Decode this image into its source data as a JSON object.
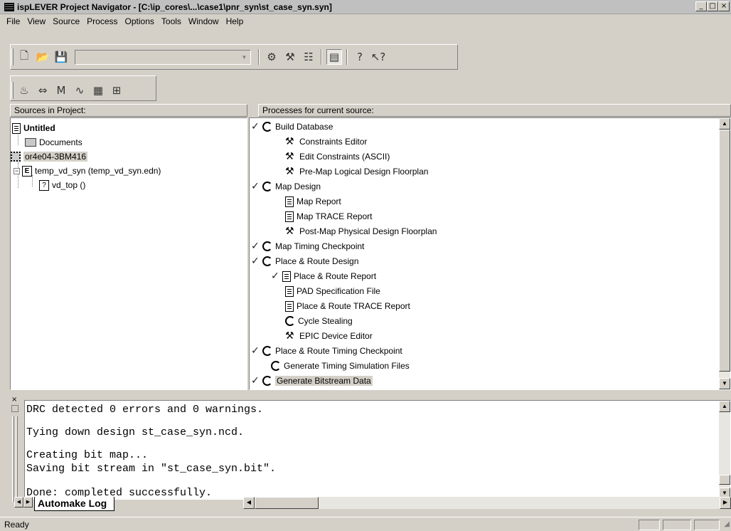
{
  "window": {
    "title": "ispLEVER Project Navigator - [C:\\ip_cores\\...\\case1\\pnr_syn\\st_case_syn.syn]",
    "minimize": "_",
    "maximize": "□",
    "close": "×"
  },
  "menu": [
    "File",
    "View",
    "Source",
    "Process",
    "Options",
    "Tools",
    "Window",
    "Help"
  ],
  "toolbar": {
    "combo_value": ""
  },
  "sources": {
    "header": "Sources in Project:",
    "items": [
      {
        "label": "Untitled"
      },
      {
        "label": "Documents"
      },
      {
        "label": "or4e04-3BM416"
      },
      {
        "label": "temp_vd_syn (temp_vd_syn.edn)"
      },
      {
        "label": "vd_top ()"
      }
    ]
  },
  "processes": {
    "header": "Processes for current source:",
    "items": [
      {
        "label": "Build Database"
      },
      {
        "label": "Constraints Editor"
      },
      {
        "label": "Edit Constraints (ASCII)"
      },
      {
        "label": "Pre-Map Logical Design Floorplan"
      },
      {
        "label": "Map Design"
      },
      {
        "label": "Map Report"
      },
      {
        "label": "Map TRACE Report"
      },
      {
        "label": "Post-Map Physical Design Floorplan"
      },
      {
        "label": "Map Timing Checkpoint"
      },
      {
        "label": "Place & Route Design"
      },
      {
        "label": "Place & Route Report"
      },
      {
        "label": "PAD Specification File"
      },
      {
        "label": "Place & Route TRACE Report"
      },
      {
        "label": "Cycle Stealing"
      },
      {
        "label": "EPIC Device Editor"
      },
      {
        "label": "Place & Route Timing Checkpoint"
      },
      {
        "label": "Generate Timing Simulation Files"
      },
      {
        "label": "Generate Bitstream Data"
      }
    ]
  },
  "log": {
    "lines": [
      "DRC detected 0 errors and 0 warnings.",
      "Tying down design st_case_syn.ncd.",
      "Creating bit map...",
      "Saving bit stream in \"st_case_syn.bit\".",
      "Done: completed successfully."
    ],
    "tab": "Automake Log"
  },
  "status": {
    "text": "Ready"
  }
}
